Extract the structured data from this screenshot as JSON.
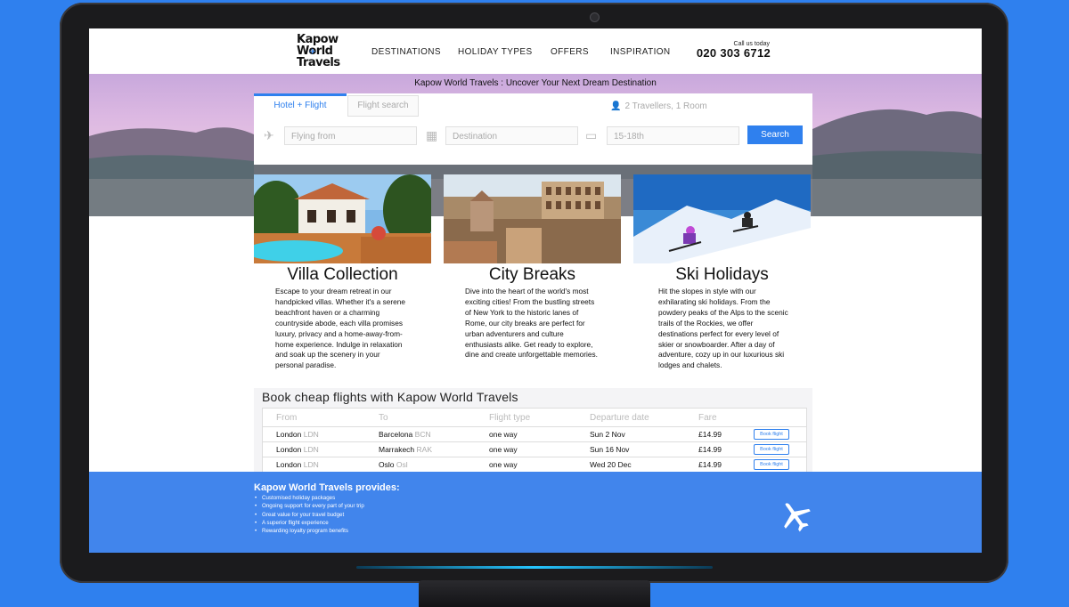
{
  "header": {
    "logo_line1": "Kapow",
    "logo_line2": "World",
    "logo_line3": "Travels",
    "nav": [
      "DESTINATIONS",
      "HOLIDAY TYPES",
      "OFFERS",
      "INSPIRATION"
    ],
    "call_label": "Call us today",
    "phone": "020 303 6712"
  },
  "hero": {
    "brand": "Kapow World Travels",
    "tagline": " : Uncover Your Next Dream Destination"
  },
  "search": {
    "tab_active": "Hotel + Flight",
    "tab_inactive": "Flight search",
    "travellers": "2 Travellers, 1 Room",
    "from_placeholder": "Flying from",
    "destination_placeholder": "Destination",
    "dates_placeholder": "15-18th",
    "button": "Search"
  },
  "cards": [
    {
      "title": "Villa Collection",
      "desc": "Escape to your dream retreat in our handpicked villas. Whether it's a serene beachfront haven or a charming countryside abode, each villa promises luxury, privacy and a home-away-from-home experience. Indulge in relaxation and soak up the scenery in your personal paradise."
    },
    {
      "title": "City Breaks",
      "desc": "Dive into the heart of the world's most exciting cities! From the bustling streets of New York to the historic lanes of Rome, our city breaks are perfect for urban adventurers and culture enthusiasts alike. Get ready to explore, dine and create unforgettable memories."
    },
    {
      "title": "Ski Holidays",
      "desc": "Hit the slopes in style with our exhilarating ski holidays. From the powdery peaks of the Alps to the scenic trails of the Rockies, we offer destinations perfect for every level of skier or snowboarder. After a day of adventure, cozy up in our luxurious ski lodges and chalets."
    }
  ],
  "flights": {
    "heading": "Book cheap flights with Kapow World Travels",
    "columns": [
      "From",
      "To",
      "Flight type",
      "Departure date",
      "Fare"
    ],
    "rows": [
      {
        "from": "London",
        "from_code": "LDN",
        "to": "Barcelona",
        "to_code": "BCN",
        "type": "one way",
        "date": "Sun 2 Nov",
        "fare": "£14.99",
        "button": "Book flight"
      },
      {
        "from": "London",
        "from_code": "LDN",
        "to": "Marrakech",
        "to_code": "RAK",
        "type": "one way",
        "date": "Sun 16 Nov",
        "fare": "£14.99",
        "button": "Book flight"
      },
      {
        "from": "London",
        "from_code": "LDN",
        "to": "Oslo",
        "to_code": "Osl",
        "type": "one way",
        "date": "Wed 20 Dec",
        "fare": "£14.99",
        "button": "Book flight"
      }
    ]
  },
  "footer": {
    "title": "Kapow World Travels provides:",
    "items": [
      "Customised holiday packages",
      "Ongoing support for every part of your trip",
      "Great value for your travel budget",
      "A superior flight experience",
      "Rewarding loyalty program benefits"
    ],
    "icon": "airplane-icon"
  },
  "colors": {
    "accent": "#2f80ee",
    "footer": "#4185ec",
    "page_bg": "#2f80ee"
  }
}
